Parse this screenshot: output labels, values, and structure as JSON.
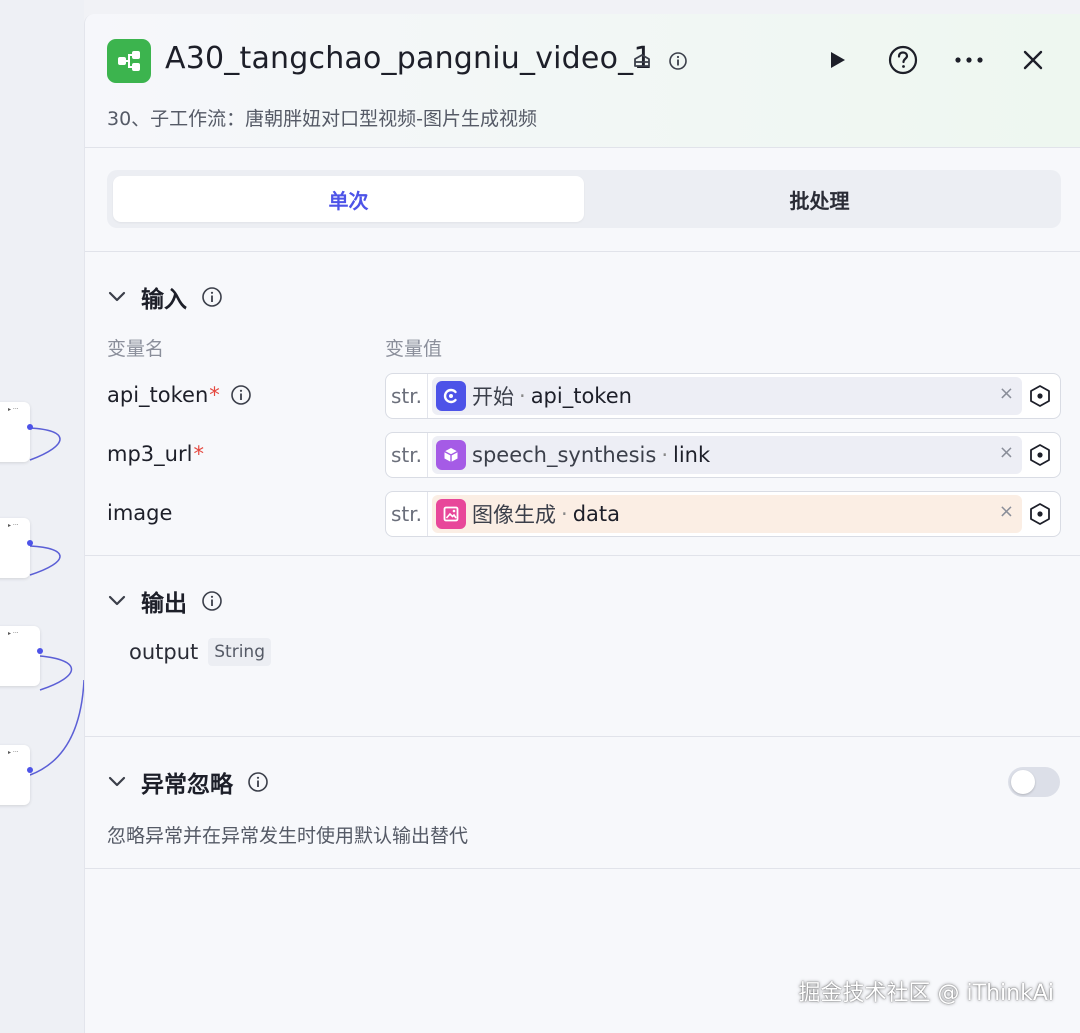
{
  "header": {
    "title": "A30_tangchao_pangniu_video_1",
    "description": "30、子工作流：唐朝胖妞对口型视频-图片生成视频",
    "logo_icon": "workflow-icon",
    "brand_color": "#3cb44e"
  },
  "tabs": [
    {
      "label": "单次",
      "active": true
    },
    {
      "label": "批处理",
      "active": false
    }
  ],
  "input": {
    "title": "输入",
    "col_name": "变量名",
    "col_value": "变量值",
    "rows": [
      {
        "name": "api_token",
        "required": "*",
        "type": "str.",
        "source": "开始",
        "sep": "·",
        "var": "api_token",
        "icon": "start-icon"
      },
      {
        "name": "mp3_url",
        "required": "*",
        "type": "str.",
        "source": "speech_synthesis",
        "sep": "·",
        "var": "link",
        "icon": "cube-icon"
      },
      {
        "name": "image",
        "required": "",
        "type": "str.",
        "source": "图像生成",
        "sep": "·",
        "var": "data",
        "icon": "image-icon"
      }
    ],
    "clear_glyph": "×"
  },
  "output": {
    "title": "输出",
    "name": "output",
    "type": "String"
  },
  "error": {
    "title": "异常忽略",
    "description": "忽略异常并在异常发生时使用默认输出替代",
    "enabled": false
  },
  "watermark": "掘金技术社区 @ iThinkAi",
  "colors": {
    "accent": "#4d53e8",
    "required": "#e5483f"
  }
}
